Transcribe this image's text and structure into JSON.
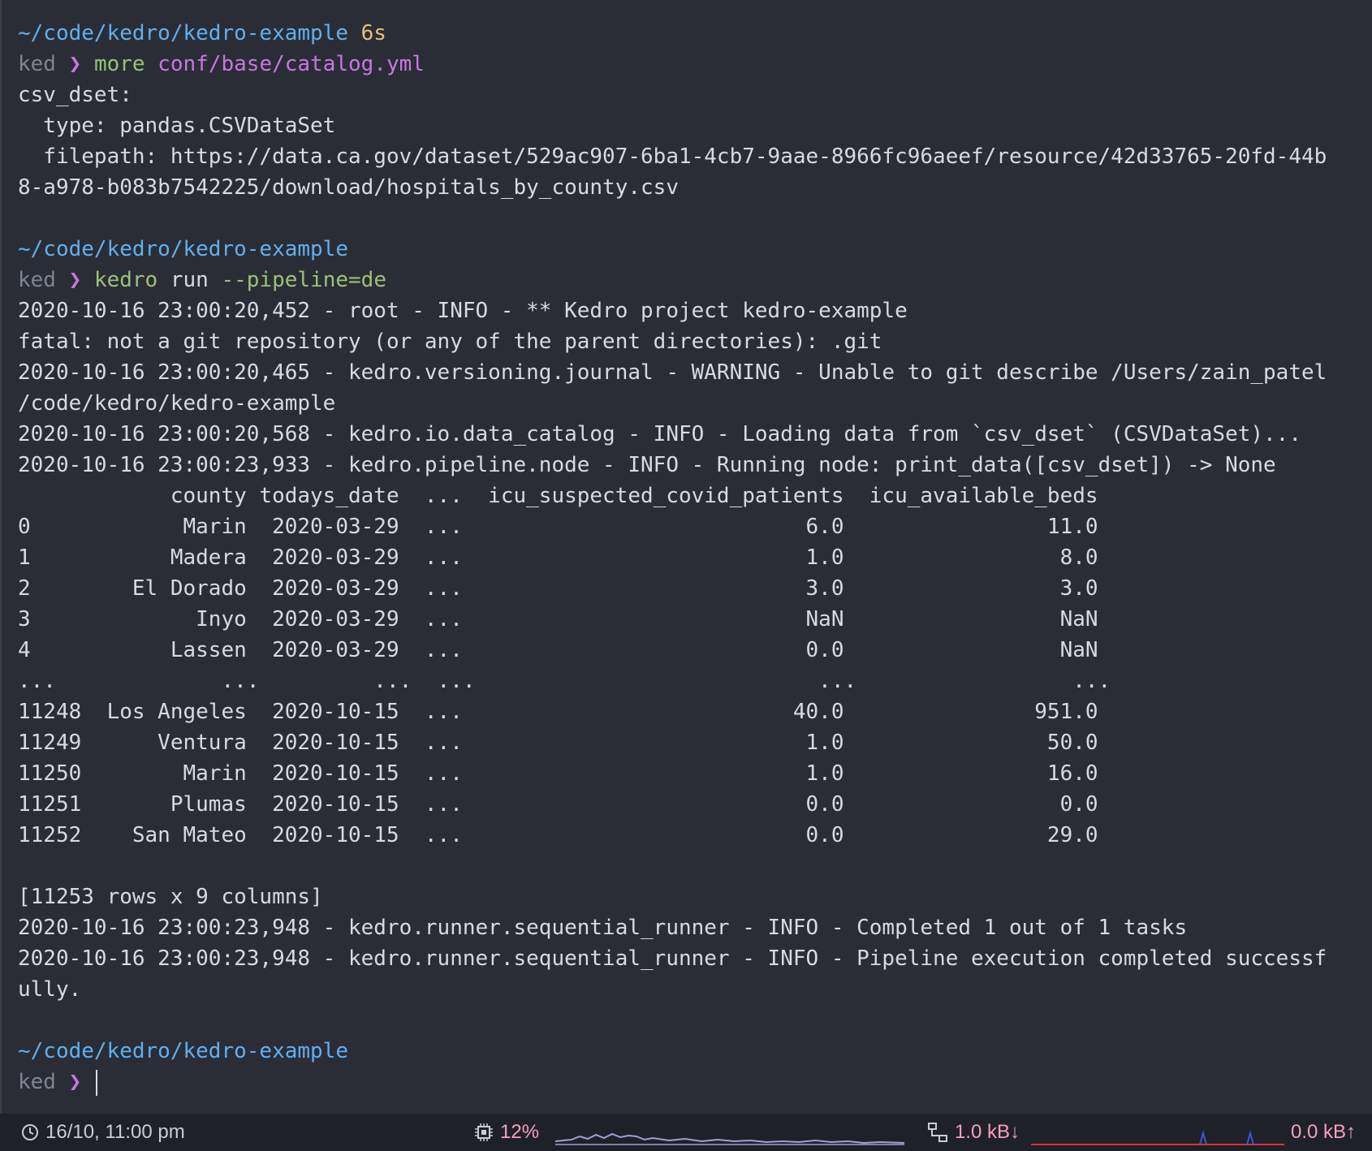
{
  "terminal": {
    "lines": [
      {
        "segments": [
          {
            "t": "~/code/kedro/kedro-example",
            "c": "path"
          },
          {
            "t": " "
          },
          {
            "t": "6s",
            "c": "dur"
          }
        ]
      },
      {
        "segments": [
          {
            "t": "ked",
            "c": "prompt-user"
          },
          {
            "t": " "
          },
          {
            "t": "❯",
            "c": "chev"
          },
          {
            "t": " "
          },
          {
            "t": "more",
            "c": "cmd"
          },
          {
            "t": " "
          },
          {
            "t": "conf/base/catalog.yml",
            "c": "arg"
          }
        ]
      },
      {
        "segments": [
          {
            "t": "csv_dset:"
          }
        ]
      },
      {
        "segments": [
          {
            "t": "  type: pandas.CSVDataSet"
          }
        ]
      },
      {
        "segments": [
          {
            "t": "  filepath: https://data.ca.gov/dataset/529ac907-6ba1-4cb7-9aae-8966fc96aeef/resource/42d33765-20fd-44b"
          }
        ]
      },
      {
        "segments": [
          {
            "t": "8-a978-b083b7542225/download/hospitals_by_county.csv"
          }
        ]
      },
      {
        "segments": [
          {
            "t": ""
          }
        ]
      },
      {
        "segments": [
          {
            "t": "~/code/kedro/kedro-example",
            "c": "path"
          }
        ]
      },
      {
        "segments": [
          {
            "t": "ked",
            "c": "prompt-user"
          },
          {
            "t": " "
          },
          {
            "t": "❯",
            "c": "chev"
          },
          {
            "t": " "
          },
          {
            "t": "kedro",
            "c": "cmd"
          },
          {
            "t": " run "
          },
          {
            "t": "--pipeline=de",
            "c": "cmd"
          }
        ]
      },
      {
        "segments": [
          {
            "t": "2020-10-16 23:00:20,452 - root - INFO - ** Kedro project kedro-example"
          }
        ]
      },
      {
        "segments": [
          {
            "t": "fatal: not a git repository (or any of the parent directories): .git"
          }
        ]
      },
      {
        "segments": [
          {
            "t": "2020-10-16 23:00:20,465 - kedro.versioning.journal - WARNING - Unable to git describe /Users/zain_patel"
          }
        ]
      },
      {
        "segments": [
          {
            "t": "/code/kedro/kedro-example"
          }
        ]
      },
      {
        "segments": [
          {
            "t": "2020-10-16 23:00:20,568 - kedro.io.data_catalog - INFO - Loading data from `csv_dset` (CSVDataSet)..."
          }
        ]
      },
      {
        "segments": [
          {
            "t": "2020-10-16 23:00:23,933 - kedro.pipeline.node - INFO - Running node: print_data([csv_dset]) -> None"
          }
        ]
      },
      {
        "segments": [
          {
            "t": "            county todays_date  ...  icu_suspected_covid_patients  icu_available_beds"
          }
        ]
      },
      {
        "segments": [
          {
            "t": "0            Marin  2020-03-29  ...                           6.0                11.0"
          }
        ]
      },
      {
        "segments": [
          {
            "t": "1           Madera  2020-03-29  ...                           1.0                 8.0"
          }
        ]
      },
      {
        "segments": [
          {
            "t": "2        El Dorado  2020-03-29  ...                           3.0                 3.0"
          }
        ]
      },
      {
        "segments": [
          {
            "t": "3             Inyo  2020-03-29  ...                           NaN                 NaN"
          }
        ]
      },
      {
        "segments": [
          {
            "t": "4           Lassen  2020-03-29  ...                           0.0                 NaN"
          }
        ]
      },
      {
        "segments": [
          {
            "t": "...             ...         ...  ...                           ...                 ..."
          }
        ]
      },
      {
        "segments": [
          {
            "t": "11248  Los Angeles  2020-10-15  ...                          40.0               951.0"
          }
        ]
      },
      {
        "segments": [
          {
            "t": "11249      Ventura  2020-10-15  ...                           1.0                50.0"
          }
        ]
      },
      {
        "segments": [
          {
            "t": "11250        Marin  2020-10-15  ...                           1.0                16.0"
          }
        ]
      },
      {
        "segments": [
          {
            "t": "11251       Plumas  2020-10-15  ...                           0.0                 0.0"
          }
        ]
      },
      {
        "segments": [
          {
            "t": "11252    San Mateo  2020-10-15  ...                           0.0                29.0"
          }
        ]
      },
      {
        "segments": [
          {
            "t": ""
          }
        ]
      },
      {
        "segments": [
          {
            "t": "[11253 rows x 9 columns]"
          }
        ]
      },
      {
        "segments": [
          {
            "t": "2020-10-16 23:00:23,948 - kedro.runner.sequential_runner - INFO - Completed 1 out of 1 tasks"
          }
        ]
      },
      {
        "segments": [
          {
            "t": "2020-10-16 23:00:23,948 - kedro.runner.sequential_runner - INFO - Pipeline execution completed successf"
          }
        ]
      },
      {
        "segments": [
          {
            "t": "ully."
          }
        ]
      },
      {
        "segments": [
          {
            "t": ""
          }
        ]
      },
      {
        "segments": [
          {
            "t": "~/code/kedro/kedro-example",
            "c": "path"
          }
        ]
      },
      {
        "segments": [
          {
            "t": "ked",
            "c": "prompt-user"
          },
          {
            "t": " "
          },
          {
            "t": "❯",
            "c": "chev"
          },
          {
            "t": " "
          }
        ],
        "cursor": true
      }
    ]
  },
  "statusbar": {
    "datetime": "16/10, 11:00 pm",
    "cpu": "12%",
    "net_down": "1.0 kB↓",
    "net_up": "0.0 kB↑",
    "icons": {
      "clock": "clock-icon",
      "cpu": "cpu-icon",
      "network": "network-icon"
    },
    "colors": {
      "cpu_graph": "#a79bd6",
      "net_graph": "#e0303a",
      "net_spike": "#3b57d8"
    }
  }
}
